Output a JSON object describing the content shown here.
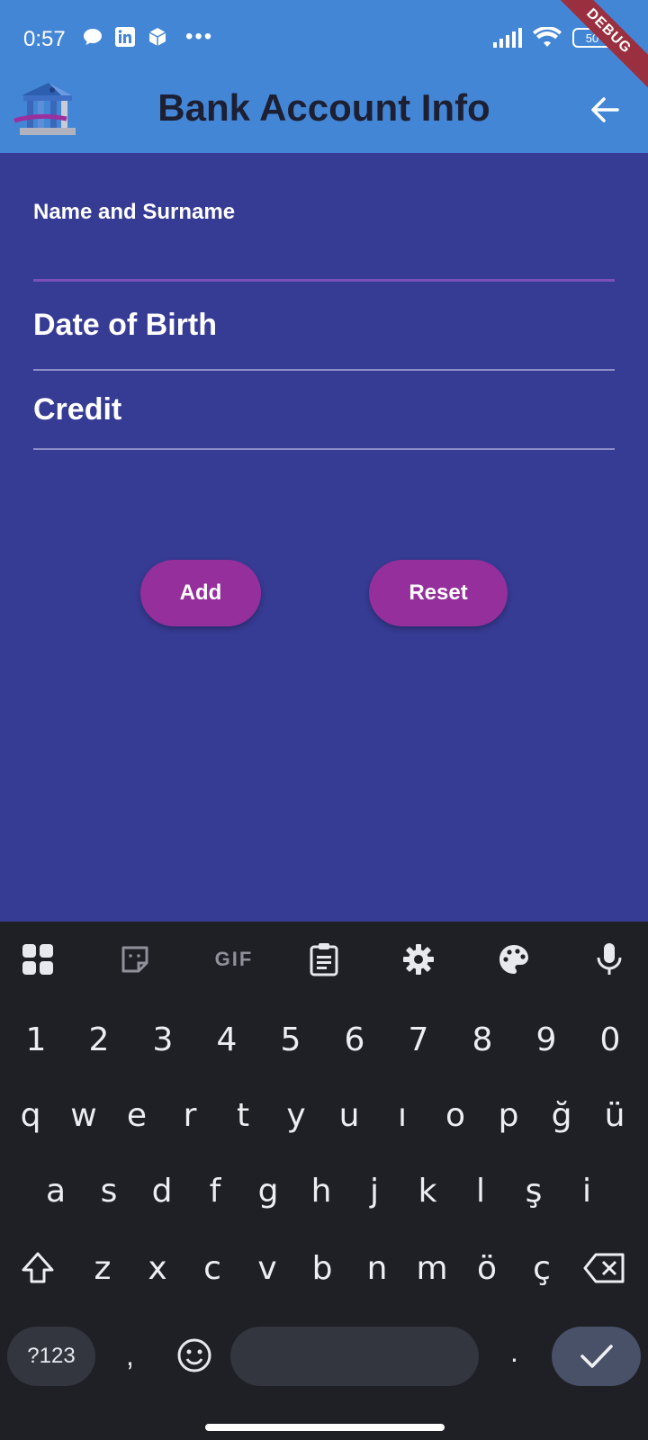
{
  "status_bar": {
    "time": "0:57",
    "overflow": "•••",
    "battery": "50",
    "icons": [
      "chat-bubble-icon",
      "linkedin-icon",
      "cube-icon",
      "signal-icon",
      "wifi-icon",
      "battery-icon"
    ]
  },
  "debug_banner": "DEBUG",
  "app_bar": {
    "title": "Bank Account Info",
    "logo_icon": "bank-building-icon",
    "back_icon": "arrow-back-icon"
  },
  "form": {
    "name_label": "Name and Surname",
    "dob_label": "Date of Birth",
    "credit_label": "Credit",
    "add_button": "Add",
    "reset_button": "Reset"
  },
  "colors": {
    "app_bar": "#4486d6",
    "background": "#363b93",
    "button": "#942f9b",
    "keyboard": "#1f2026"
  },
  "keyboard": {
    "toolbar": [
      "grid-icon",
      "sticker-icon",
      "GIF",
      "clipboard-icon",
      "gear-icon",
      "palette-icon",
      "microphone-icon"
    ],
    "gif_label": "GIF",
    "digits": [
      "1",
      "2",
      "3",
      "4",
      "5",
      "6",
      "7",
      "8",
      "9",
      "0"
    ],
    "row1": [
      "q",
      "w",
      "e",
      "r",
      "t",
      "y",
      "u",
      "ı",
      "o",
      "p",
      "ğ",
      "ü"
    ],
    "row2": [
      "a",
      "s",
      "d",
      "f",
      "g",
      "h",
      "j",
      "k",
      "l",
      "ş",
      "i"
    ],
    "row3": [
      "z",
      "x",
      "c",
      "v",
      "b",
      "n",
      "m",
      "ö",
      "ç"
    ],
    "symbols_key": "?123",
    "comma_key": ",",
    "period_key": "."
  }
}
